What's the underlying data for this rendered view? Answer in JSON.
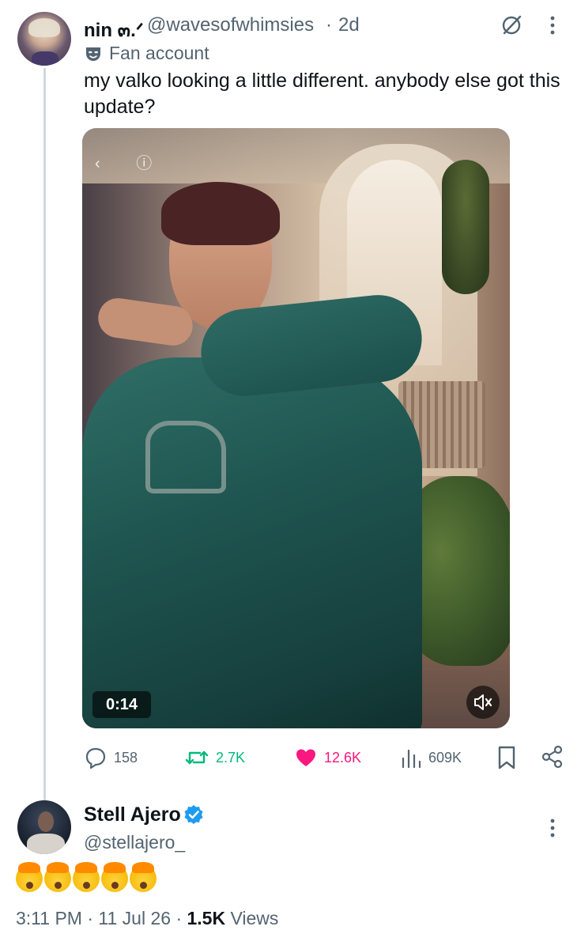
{
  "original_post": {
    "display_name": "nin ๓.ᐟ",
    "handle": "@wavesofwhimsies",
    "separator": "·",
    "time_ago": "2d",
    "label_badge": "Fan account",
    "text": "my valko looking a little different. anybody else got this update?",
    "media": {
      "type": "video",
      "duration": "0:14",
      "muted": true
    },
    "actions": {
      "replies": "158",
      "reposts": "2.7K",
      "likes": "12.6K",
      "views": "609K",
      "liked": true,
      "reposted": true
    },
    "icons": {
      "reply": "speech-bubble-icon",
      "repost": "repost-arrows-icon",
      "like": "heart-icon",
      "views": "bar-chart-icon",
      "bookmark": "bookmark-icon",
      "share": "share-icon",
      "grok": "grok-icon",
      "more": "more-vertical-icon"
    }
  },
  "reply": {
    "display_name": "Stell Ajero",
    "verified": true,
    "handle": "@stellajero_",
    "emoji_count": 5,
    "emoji": "exploding-head-icon"
  },
  "meta": {
    "time": "3:11 PM",
    "dot": "·",
    "date": "11 Jul 26",
    "views_count": "1.5K",
    "views_label": "Views"
  },
  "colors": {
    "text": "#0f1419",
    "secondary": "#536471",
    "repost_green": "#00ba7c",
    "like_pink": "#f91880",
    "verified_blue": "#1d9bf0",
    "thread_line": "#cfd9de"
  }
}
